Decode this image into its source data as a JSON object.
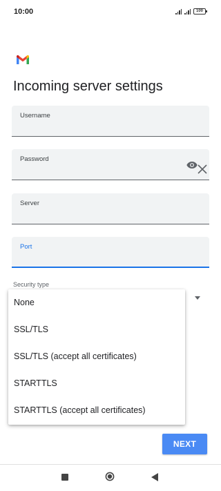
{
  "status_bar": {
    "time": "10:00",
    "battery": "100"
  },
  "app": {
    "logo_icon": "gmail-logo",
    "title": "Incoming server settings"
  },
  "form": {
    "username_label": "Username",
    "username_value": "",
    "password_label": "Password",
    "password_value": "",
    "server_label": "Server",
    "server_value": "",
    "port_label": "Port",
    "port_value": "",
    "security_type_label": "Security type"
  },
  "security_menu": {
    "options": [
      "None",
      "SSL/TLS",
      "SSL/TLS (accept all certificates)",
      "STARTTLS",
      "STARTTLS (accept all certificates)"
    ]
  },
  "actions": {
    "next_label": "NEXT"
  },
  "colors": {
    "accent": "#1a73e8",
    "button": "#4a8af4",
    "field_background": "#f1f3f4"
  },
  "icons": {
    "password_toggle": "eye-icon",
    "clear": "close-icon",
    "dropdown": "dropdown-arrow-icon",
    "nav_recents": "square-icon",
    "nav_home": "circle-icon",
    "nav_back": "back-triangle-icon"
  }
}
